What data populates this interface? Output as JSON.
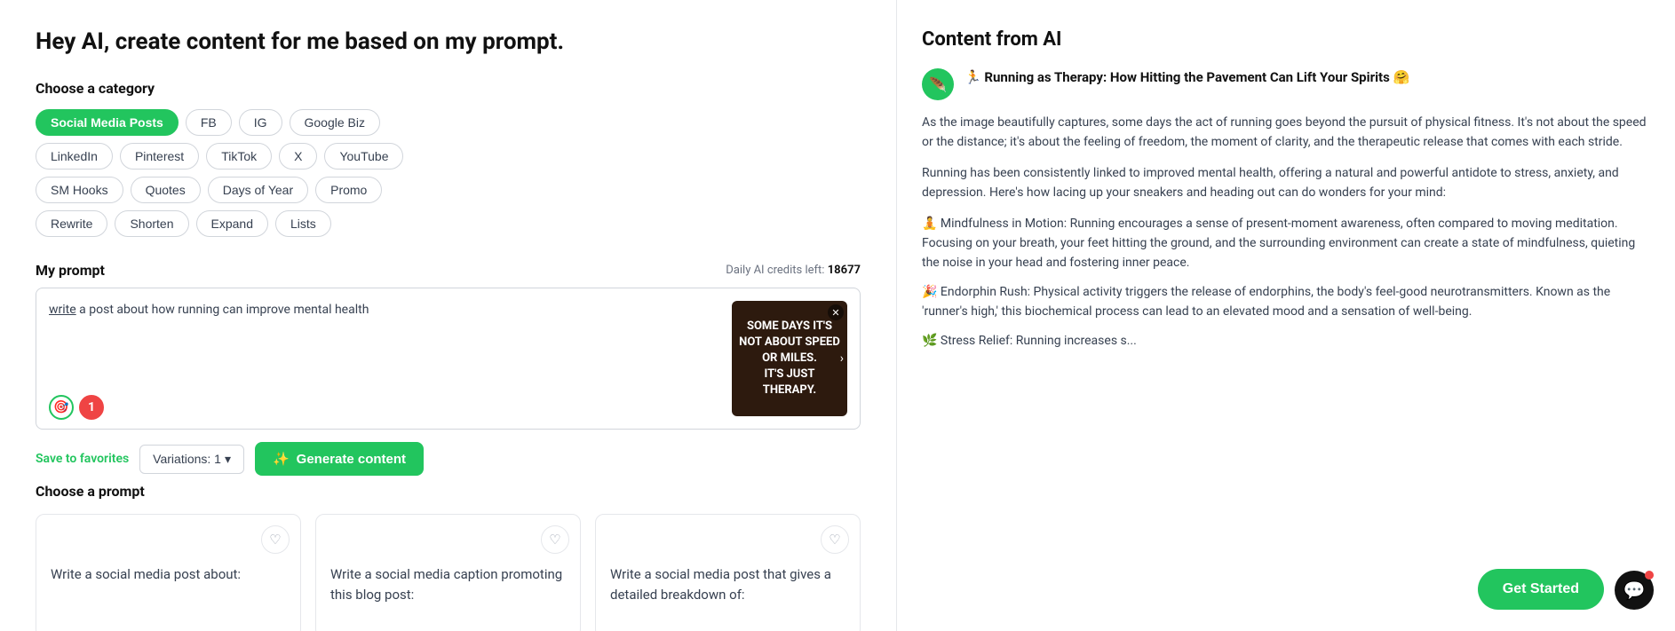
{
  "page": {
    "title": "Hey AI, create content for me based on my prompt."
  },
  "left": {
    "category_section_title": "Choose a category",
    "categories_row1": [
      "Social Media Posts",
      "FB",
      "IG",
      "Google Biz"
    ],
    "categories_row2": [
      "LinkedIn",
      "Pinterest",
      "TikTok",
      "X",
      "YouTube"
    ],
    "categories_row3": [
      "SM Hooks",
      "Quotes",
      "Days of Year",
      "Promo"
    ],
    "categories_row4": [
      "Rewrite",
      "Shorten",
      "Expand",
      "Lists"
    ],
    "active_category": "Social Media Posts",
    "prompt_title": "My prompt",
    "credits_label": "Daily AI credits left:",
    "credits_value": "18677",
    "prompt_text_pre": "write",
    "prompt_text_rest": " a post about how running can improve mental health",
    "image_text": "Some days it's not about speed or miles. It's just therapy.",
    "notification_count": "1",
    "save_favorites": "Save to favorites",
    "variations_label": "Variations: 1",
    "generate_label": "Generate content",
    "choose_prompt_title": "Choose a prompt",
    "prompt_cards": [
      {
        "text": "Write a social media post about:"
      },
      {
        "text": "Write a social media caption promoting this blog post:"
      },
      {
        "text": "Write a social media post that gives a detailed breakdown of:"
      }
    ]
  },
  "right": {
    "title": "Content from AI",
    "post_title": "🏃 Running as Therapy: How Hitting the Pavement Can Lift Your Spirits 🤗",
    "para1": "As the image beautifully captures, some days the act of running goes beyond the pursuit of physical fitness. It's not about the speed or the distance; it's about the feeling of freedom, the moment of clarity, and the therapeutic release that comes with each stride.",
    "para2": "Running has been consistently linked to improved mental health, offering a natural and powerful antidote to stress, anxiety, and depression. Here's how lacing up your sneakers and heading out can do wonders for your mind:",
    "bullet1": "🧘 Mindfulness in Motion: Running encourages a sense of present-moment awareness, often compared to moving meditation. Focusing on your breath, your feet hitting the ground, and the surrounding environment can create a state of mindfulness, quieting the noise in your head and fostering inner peace.",
    "bullet2": "🎉 Endorphin Rush: Physical activity triggers the release of endorphins, the body's feel-good neurotransmitters. Known as the 'runner's high,' this biochemical process can lead to an elevated mood and a sensation of well-being.",
    "bullet3": "🌿 Stress Relief: Running increases s...",
    "get_started_label": "Get Started"
  }
}
